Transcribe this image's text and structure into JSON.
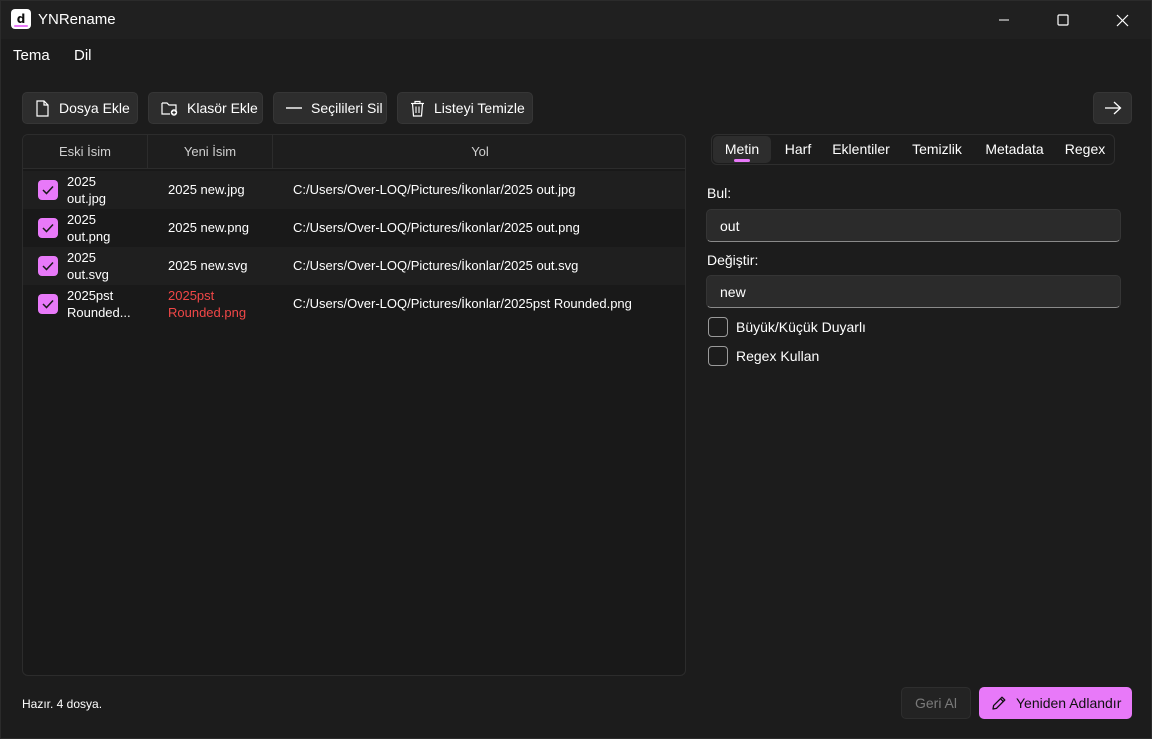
{
  "app": {
    "title": "YNRename",
    "logo_text": "d"
  },
  "menu": {
    "items": [
      "Tema",
      "Dil"
    ]
  },
  "toolbar": {
    "add_file": "Dosya Ekle",
    "add_folder": "Klasör Ekle",
    "remove_selected": "Seçilileri Sil",
    "clear_list": "Listeyi Temizle"
  },
  "table": {
    "columns": [
      "Eski İsim",
      "Yeni İsim",
      "Yol"
    ],
    "rows": [
      {
        "checked": true,
        "old_name": [
          "2025",
          "out.jpg"
        ],
        "new_name": [
          "2025 new.jpg"
        ],
        "path": "C:/Users/Over-LOQ/Pictures/İkonlar/2025 out.jpg",
        "conflict": false
      },
      {
        "checked": true,
        "old_name": [
          "2025",
          "out.png"
        ],
        "new_name": [
          "2025 new.png"
        ],
        "path": "C:/Users/Over-LOQ/Pictures/İkonlar/2025 out.png",
        "conflict": false
      },
      {
        "checked": true,
        "old_name": [
          "2025",
          "out.svg"
        ],
        "new_name": [
          "2025 new.svg"
        ],
        "path": "C:/Users/Over-LOQ/Pictures/İkonlar/2025 out.svg",
        "conflict": false
      },
      {
        "checked": true,
        "old_name": [
          "2025pst",
          "Rounded..."
        ],
        "new_name": [
          "2025pst",
          "Rounded.png"
        ],
        "path": "C:/Users/Over-LOQ/Pictures/İkonlar/2025pst Rounded.png",
        "conflict": true
      }
    ]
  },
  "tabs": {
    "items": [
      "Metin",
      "Harf",
      "Eklentiler",
      "Temizlik",
      "Metadata",
      "Regex"
    ],
    "active": "Metin"
  },
  "form": {
    "find_label": "Bul:",
    "find_value": "out",
    "replace_label": "Değiştir:",
    "replace_value": "new",
    "case_sensitive_label": "Büyük/Küçük Duyarlı",
    "case_sensitive_checked": false,
    "use_regex_label": "Regex Kullan",
    "use_regex_checked": false
  },
  "status": {
    "text": "Hazır. 4 dosya."
  },
  "actions": {
    "undo": "Geri Al",
    "rename": "Yeniden Adlandır"
  },
  "colors": {
    "accent": "#e879f9",
    "background": "#1c1c1c",
    "error": "#f04747"
  }
}
